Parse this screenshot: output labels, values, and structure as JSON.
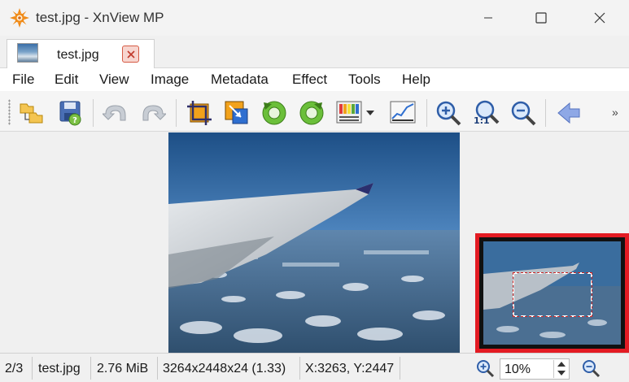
{
  "window": {
    "title": "test.jpg - XnView MP",
    "minimize_glyph": "—",
    "close_glyph": "✕"
  },
  "tab": {
    "label": "test.jpg"
  },
  "menu": {
    "items": [
      "File",
      "Edit",
      "View",
      "Image",
      "Metadata",
      "Effect",
      "Tools",
      "Help"
    ]
  },
  "toolbar": {
    "buttons": [
      "open-folder-icon",
      "save-icon",
      "undo-icon",
      "redo-icon",
      "crop-icon",
      "resize-icon",
      "rotate-left-icon",
      "rotate-right-icon",
      "adjust-colors-icon",
      "levels-icon",
      "zoom-in-icon",
      "zoom-1to1-icon",
      "zoom-out-icon",
      "previous-arrow-icon"
    ],
    "one_to_one_label": "1:1",
    "more_glyph": "»"
  },
  "status": {
    "index": "2/3",
    "filename": "test.jpg",
    "filesize": "2.76 MiB",
    "dimensions": "3264x2448x24 (1.33)",
    "cursor": "X:3263, Y:2447",
    "zoom": "10%"
  },
  "colors": {
    "accent_red": "#e31b23",
    "sky_dark": "#1d4f86",
    "sky_light": "#7fa9d2",
    "toolbar_orange": "#f2a21b",
    "toolbar_blue": "#2f6fd0",
    "toolbar_green": "#5aa83a"
  }
}
